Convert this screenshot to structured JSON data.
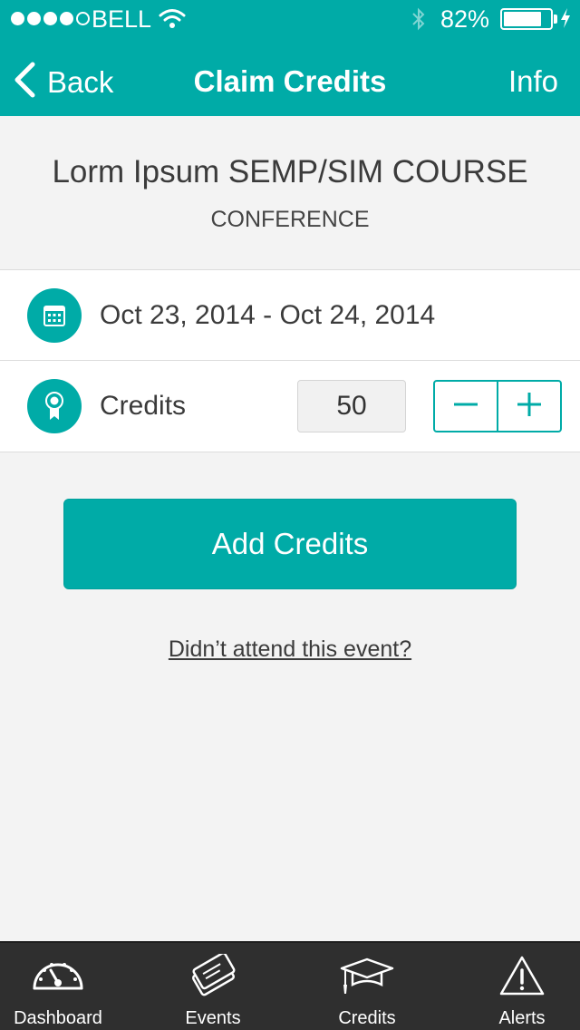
{
  "status_bar": {
    "carrier": "BELL",
    "battery_percent": "82%",
    "battery_level": 0.82
  },
  "nav": {
    "back_label": "Back",
    "title": "Claim Credits",
    "info_label": "Info"
  },
  "event": {
    "title": "Lorm Ipsum SEMP/SIM COURSE",
    "type": "CONFERENCE",
    "dates": "Oct 23, 2014 - Oct 24, 2014"
  },
  "credits": {
    "label": "Credits",
    "value": "50"
  },
  "actions": {
    "add_credits_label": "Add Credits",
    "didnt_attend_label": "Didn’t attend this event?"
  },
  "tabbar": {
    "items": [
      {
        "label": "Dashboard",
        "icon": "dashboard-gauge-icon"
      },
      {
        "label": "Events",
        "icon": "events-tickets-icon"
      },
      {
        "label": "Credits",
        "icon": "graduation-cap-icon"
      },
      {
        "label": "Alerts",
        "icon": "warning-triangle-icon"
      }
    ]
  },
  "colors": {
    "accent": "#00aba7",
    "tabbar_bg": "#2f2f2f",
    "page_bg": "#f3f3f3"
  }
}
